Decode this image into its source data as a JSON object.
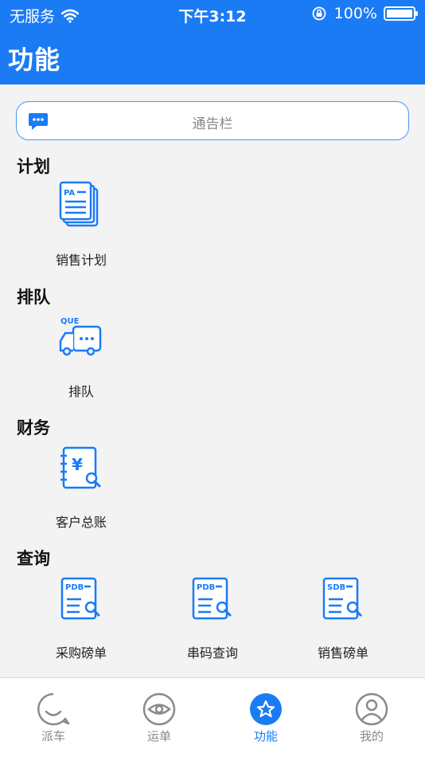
{
  "status_bar": {
    "carrier": "无服务",
    "time": "下午3:12",
    "battery": "100%",
    "battery_level": 100
  },
  "header": {
    "title": "功能"
  },
  "notice": {
    "placeholder": "通告栏",
    "icon": "message-icon"
  },
  "sections": [
    {
      "title": "计划",
      "items": [
        {
          "label": "销售计划",
          "icon": "document-pa-icon"
        }
      ]
    },
    {
      "title": "排队",
      "items": [
        {
          "label": "排队",
          "icon": "truck-queue-icon"
        }
      ]
    },
    {
      "title": "财务",
      "items": [
        {
          "label": "客户总账",
          "icon": "ledger-yen-icon"
        }
      ]
    },
    {
      "title": "查询",
      "items": [
        {
          "label": "采购磅单",
          "icon": "pdb-search-icon"
        },
        {
          "label": "串码查询",
          "icon": "pdb-search-icon"
        },
        {
          "label": "销售磅单",
          "icon": "sdb-search-icon"
        }
      ]
    }
  ],
  "tabbar": {
    "tabs": [
      {
        "label": "派车",
        "icon": "smile-bubble-icon"
      },
      {
        "label": "运单",
        "icon": "eye-icon"
      },
      {
        "label": "功能",
        "icon": "star-icon",
        "active": true
      },
      {
        "label": "我的",
        "icon": "user-icon"
      }
    ]
  },
  "colors": {
    "primary": "#1a7bf5",
    "background": "#f3f3f3",
    "inactive": "#8a8a8a"
  }
}
